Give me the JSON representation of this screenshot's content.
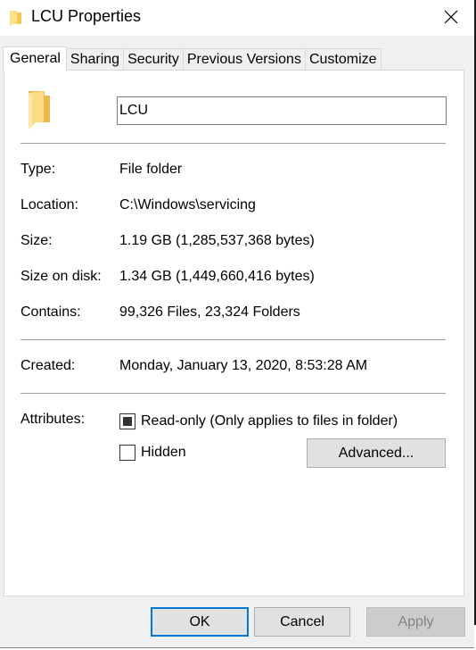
{
  "window": {
    "title": "LCU Properties",
    "title_icon": "folder-icon",
    "close_icon": "close-icon"
  },
  "tabs": [
    {
      "label": "General",
      "active": true
    },
    {
      "label": "Sharing",
      "active": false
    },
    {
      "label": "Security",
      "active": false
    },
    {
      "label": "Previous Versions",
      "active": false
    },
    {
      "label": "Customize",
      "active": false
    }
  ],
  "general": {
    "folder_icon": "folder-icon",
    "name_value": "LCU",
    "properties": [
      {
        "label": "Type:",
        "value": "File folder"
      },
      {
        "label": "Location:",
        "value": "C:\\Windows\\servicing"
      },
      {
        "label": "Size:",
        "value": "1.19 GB (1,285,537,368 bytes)"
      },
      {
        "label": "Size on disk:",
        "value": "1.34 GB (1,449,660,416 bytes)"
      },
      {
        "label": "Contains:",
        "value": "99,326 Files, 23,324 Folders"
      }
    ],
    "created": {
      "label": "Created:",
      "value": "Monday, January 13, 2020, 8:53:28 AM"
    },
    "attributes": {
      "label": "Attributes:",
      "readonly": {
        "label": "Read-only (Only applies to files in folder)",
        "state": "indeterminate"
      },
      "hidden": {
        "label": "Hidden",
        "state": "unchecked"
      },
      "advanced_label": "Advanced..."
    }
  },
  "footer": {
    "ok_label": "OK",
    "cancel_label": "Cancel",
    "apply_label": "Apply",
    "apply_enabled": false
  },
  "colors": {
    "accent": "#0078d7",
    "folder": "#f8d775"
  }
}
